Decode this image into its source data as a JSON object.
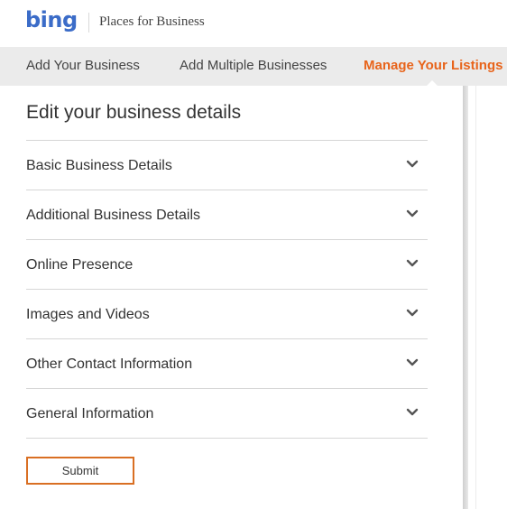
{
  "brand": {
    "logo_text": "bing",
    "logo_color": "#3b6cc8",
    "product_name": "Places for Business"
  },
  "nav": {
    "items": [
      {
        "label": "Add Your Business"
      },
      {
        "label": "Add Multiple Businesses"
      },
      {
        "label": "Manage Your Listings",
        "active": true
      }
    ],
    "active_color": "#e8641b"
  },
  "main": {
    "title": "Edit your business details",
    "sections": [
      {
        "label": "Basic Business Details",
        "icon": "chevron-down-icon"
      },
      {
        "label": "Additional Business Details",
        "icon": "chevron-down-icon"
      },
      {
        "label": "Online Presence",
        "icon": "chevron-down-icon"
      },
      {
        "label": "Images and Videos",
        "icon": "chevron-down-icon"
      },
      {
        "label": "Other Contact Information",
        "icon": "chevron-down-icon"
      },
      {
        "label": "General Information",
        "icon": "chevron-down-icon"
      }
    ],
    "submit_label": "Submit",
    "submit_border_color": "#d96f23"
  }
}
